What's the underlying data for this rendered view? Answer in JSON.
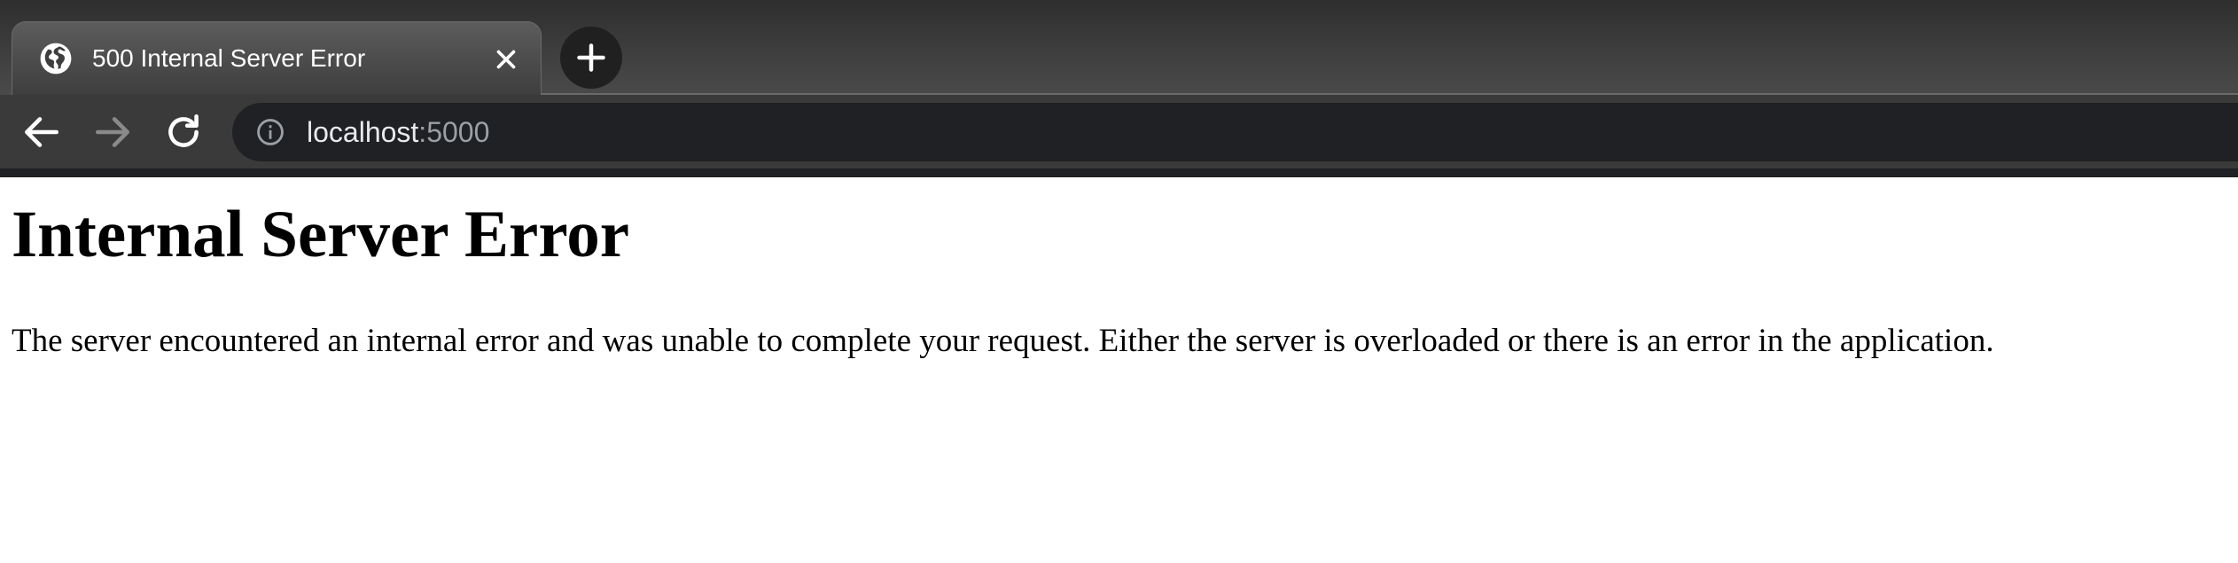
{
  "browser": {
    "tab": {
      "title": "500 Internal Server Error",
      "favicon": "globe-icon",
      "close_icon": "close-icon"
    },
    "new_tab_icon": "plus-icon",
    "toolbar": {
      "back_icon": "back-arrow-icon",
      "forward_icon": "forward-arrow-icon",
      "reload_icon": "reload-icon"
    },
    "omnibox": {
      "info_icon": "info-icon",
      "host": "localhost",
      "port": ":5000"
    },
    "colors": {
      "tabstrip": "#3d3d3d",
      "toolbar": "#3a3a3a",
      "omnibox": "#202124",
      "url_host": "#e8eaed",
      "url_port": "#9aa0a6"
    }
  },
  "page": {
    "heading": "Internal Server Error",
    "message": "The server encountered an internal error and was unable to complete your request. Either the server is overloaded or there is an error in the application."
  }
}
